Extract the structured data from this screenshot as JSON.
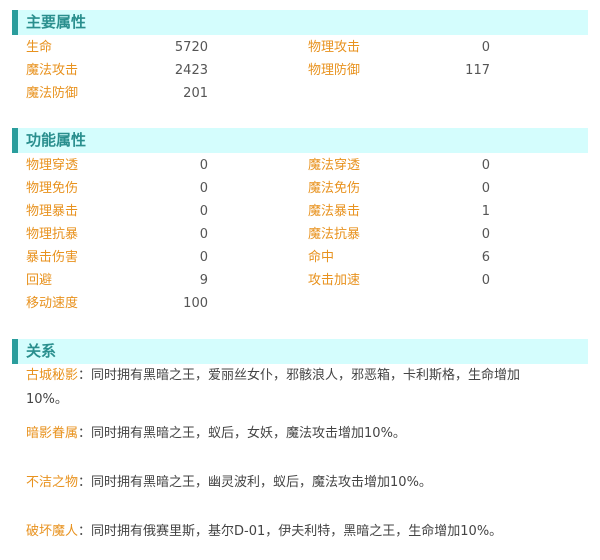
{
  "main": {
    "title": "主要属性",
    "rows": [
      {
        "l1": "生命",
        "v1": "5720",
        "l2": "物理攻击",
        "v2": "0"
      },
      {
        "l1": "魔法攻击",
        "v1": "2423",
        "l2": "物理防御",
        "v2": "117"
      },
      {
        "l1": "魔法防御",
        "v1": "201",
        "l2": "",
        "v2": ""
      }
    ]
  },
  "func": {
    "title": "功能属性",
    "rows": [
      {
        "l1": "物理穿透",
        "v1": "0",
        "l2": "魔法穿透",
        "v2": "0"
      },
      {
        "l1": "物理免伤",
        "v1": "0",
        "l2": "魔法免伤",
        "v2": "0"
      },
      {
        "l1": "物理暴击",
        "v1": "0",
        "l2": "魔法暴击",
        "v2": "1"
      },
      {
        "l1": "物理抗暴",
        "v1": "0",
        "l2": "魔法抗暴",
        "v2": "0"
      },
      {
        "l1": "暴击伤害",
        "v1": "0",
        "l2": "命中",
        "v2": "6"
      },
      {
        "l1": "回避",
        "v1": "9",
        "l2": "攻击加速",
        "v2": "0"
      },
      {
        "l1": "移动速度",
        "v1": "100",
        "l2": "",
        "v2": ""
      }
    ]
  },
  "relations": {
    "title": "关系",
    "items": [
      {
        "name": "古城秘影",
        "sep": "：",
        "text_line1": "同时拥有黑暗之王，爱丽丝女仆，邪骸浪人，邪恶箱，卡利斯格，生命增加",
        "text_line2": "10%。"
      },
      {
        "name": "暗影眷属",
        "sep": "：",
        "text_line1": "同时拥有黑暗之王，蚁后，女妖，魔法攻击增加10%。",
        "text_line2": ""
      },
      {
        "name": "不洁之物",
        "sep": "：",
        "text_line1": "同时拥有黑暗之王，幽灵波利，蚁后，魔法攻击增加10%。",
        "text_line2": ""
      },
      {
        "name": "破坏魔人",
        "sep": "：",
        "text_line1": "同时拥有俄赛里斯，基尔D-01，伊夫利特，黑暗之王，生命增加10%。",
        "text_line2": ""
      }
    ]
  }
}
